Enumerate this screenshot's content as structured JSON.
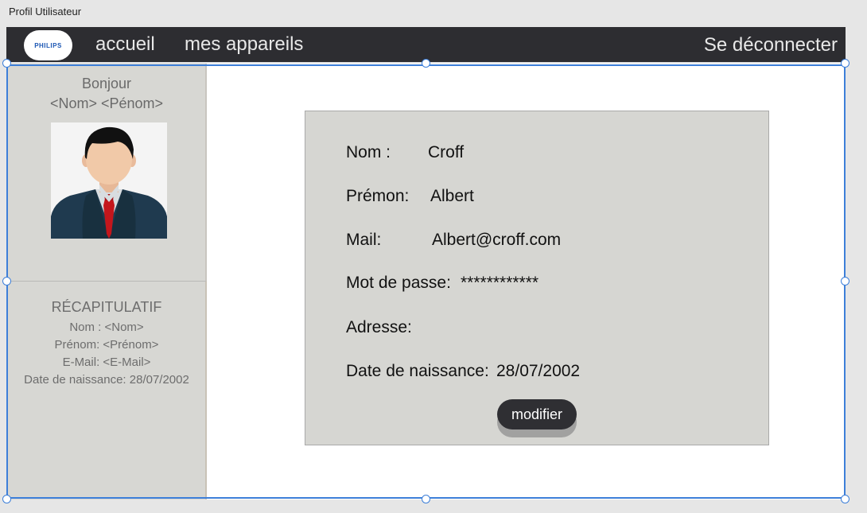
{
  "window": {
    "title": "Profil Utilisateur"
  },
  "navbar": {
    "logo_text": "PHILIPS",
    "home": "accueil",
    "devices": "mes appareils",
    "logout": "Se déconnecter"
  },
  "sidebar": {
    "greeting": "Bonjour",
    "name_placeholder": "<Nom> <Pénom>",
    "recap": {
      "title": "RÉCAPITULATIF",
      "lines": [
        "Nom : <Nom>",
        "Prénom: <Prénom>",
        "E-Mail: <E-Mail>",
        "Date de naissance: 28/07/2002"
      ]
    }
  },
  "profile": {
    "fields": [
      {
        "label": "Nom :",
        "value": "Croff"
      },
      {
        "label": "Prémon:",
        "value": "Albert"
      },
      {
        "label": "Mail:",
        "value": "Albert@croff.com"
      },
      {
        "label": "Mot de passe:",
        "value": "************"
      },
      {
        "label": "Adresse:",
        "value": ""
      },
      {
        "label": "Date de naissance:",
        "value": "28/07/2002"
      }
    ],
    "edit_button": "modifier"
  },
  "colors": {
    "navbar_bg": "#2d2d31",
    "panel_bg": "#d7d7d3",
    "selection_accent": "#3d7fd9"
  }
}
